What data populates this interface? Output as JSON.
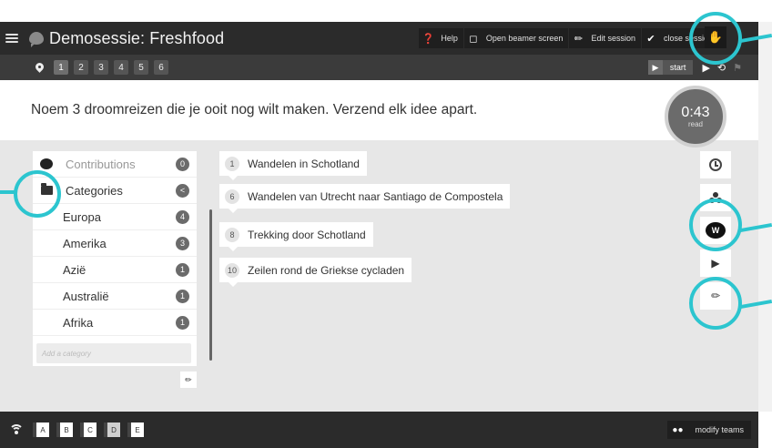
{
  "header": {
    "title": "Demosessie: Freshfood",
    "actions": [
      {
        "icon": "help-icon",
        "label": "Help"
      },
      {
        "icon": "monitor-icon",
        "label": "Open beamer screen"
      },
      {
        "icon": "pencil-icon",
        "label": "Edit session"
      },
      {
        "icon": "check-icon",
        "label": "close session"
      }
    ]
  },
  "subheader": {
    "questions": [
      "1",
      "2",
      "3",
      "4",
      "5",
      "6"
    ],
    "active_question": "1",
    "start_label": "start"
  },
  "question": {
    "text": "Noem 3 droomreizen die je ooit nog wilt maken. Verzend elk idee apart."
  },
  "timer": {
    "value": "0:43",
    "sub": "read"
  },
  "panel": {
    "contributions": {
      "label": "Contributions",
      "count": "0"
    },
    "categories": {
      "label": "Categories",
      "count": "<"
    },
    "items": [
      {
        "label": "Europa",
        "count": "4"
      },
      {
        "label": "Amerika",
        "count": "3"
      },
      {
        "label": "Azië",
        "count": "1"
      },
      {
        "label": "Australië",
        "count": "1"
      },
      {
        "label": "Afrika",
        "count": "1"
      }
    ],
    "add_placeholder": "Add a category"
  },
  "cards": [
    {
      "num": "1",
      "text": "Wandelen in Schotland"
    },
    {
      "num": "6",
      "text": "Wandelen van Utrecht naar Santiago de Compostela"
    },
    {
      "num": "8",
      "text": "Trekking door Schotland"
    },
    {
      "num": "10",
      "text": "Zeilen rond de Griekse cycladen"
    }
  ],
  "tools": {
    "wordcloud_letter": "W"
  },
  "footer": {
    "teams": [
      "A",
      "B",
      "C",
      "D",
      "E"
    ],
    "active_team": "D",
    "modify_label": "modify teams"
  },
  "colors": {
    "highlight": "#2cc5cf",
    "header_bg": "#2b2b2b",
    "main_bg": "#e7e7e7"
  }
}
